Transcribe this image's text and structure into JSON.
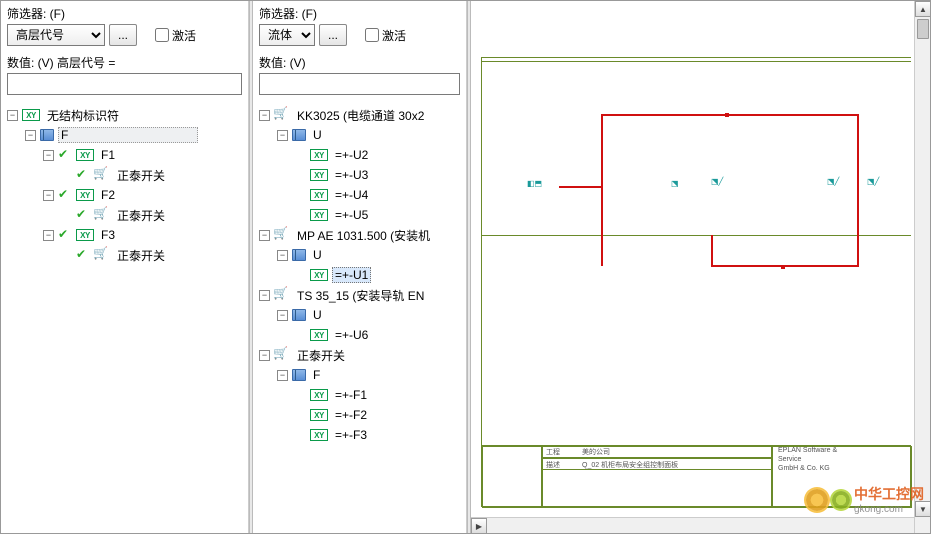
{
  "leftPanel": {
    "filterLabel": "筛选器: (F)",
    "filterCombo": "高层代号",
    "activateLabel": "激活",
    "valueLabel": "数值: (V) 高层代号 =",
    "valueInput": "",
    "ellipsis": "...",
    "tree": [
      {
        "level": 0,
        "exp": "-",
        "icon": "xy",
        "label": "无结构标识符"
      },
      {
        "level": 1,
        "exp": "-",
        "icon": "book",
        "label": "F",
        "sel": true
      },
      {
        "level": 2,
        "exp": "-",
        "icon": "check",
        "sub": "xy",
        "label": "F1"
      },
      {
        "level": 3,
        "exp": "",
        "icon": "check",
        "sub": "cart",
        "label": "正泰开关"
      },
      {
        "level": 2,
        "exp": "-",
        "icon": "check",
        "sub": "xy",
        "label": "F2"
      },
      {
        "level": 3,
        "exp": "",
        "icon": "check",
        "sub": "cart",
        "label": "正泰开关"
      },
      {
        "level": 2,
        "exp": "-",
        "icon": "check",
        "sub": "xy",
        "label": "F3"
      },
      {
        "level": 3,
        "exp": "",
        "icon": "check",
        "sub": "cart",
        "label": "正泰开关"
      }
    ]
  },
  "midPanel": {
    "filterLabel": "筛选器: (F)",
    "filterCombo": "流体",
    "activateLabel": "激活",
    "valueLabel": "数值: (V)",
    "valueInput": "",
    "ellipsis": "...",
    "tree": [
      {
        "level": 0,
        "exp": "-",
        "icon": "cart",
        "label": "KK3025 (电缆通道 30x2"
      },
      {
        "level": 1,
        "exp": "-",
        "icon": "book",
        "label": "U"
      },
      {
        "level": 2,
        "exp": "",
        "icon": "xy",
        "label": "=+-U2"
      },
      {
        "level": 2,
        "exp": "",
        "icon": "xy",
        "label": "=+-U3"
      },
      {
        "level": 2,
        "exp": "",
        "icon": "xy",
        "label": "=+-U4"
      },
      {
        "level": 2,
        "exp": "",
        "icon": "xy",
        "label": "=+-U5"
      },
      {
        "level": 0,
        "exp": "-",
        "icon": "cart",
        "label": "MP AE 1031.500 (安装机"
      },
      {
        "level": 1,
        "exp": "-",
        "icon": "book",
        "label": "U"
      },
      {
        "level": 2,
        "exp": "",
        "icon": "xy",
        "label": "=+-U1",
        "sel": true
      },
      {
        "level": 0,
        "exp": "-",
        "icon": "cart",
        "label": "TS 35_15 (安装导轨 EN"
      },
      {
        "level": 1,
        "exp": "-",
        "icon": "book",
        "label": "U"
      },
      {
        "level": 2,
        "exp": "",
        "icon": "xy",
        "label": "=+-U6"
      },
      {
        "level": 0,
        "exp": "-",
        "icon": "cart",
        "label": "正泰开关"
      },
      {
        "level": 1,
        "exp": "-",
        "icon": "book",
        "label": "F"
      },
      {
        "level": 2,
        "exp": "",
        "icon": "xy",
        "label": "=+-F1"
      },
      {
        "level": 2,
        "exp": "",
        "icon": "xy",
        "label": "=+-F2"
      },
      {
        "level": 2,
        "exp": "",
        "icon": "xy",
        "label": "=+-F3"
      }
    ]
  },
  "watermark": {
    "brand": "中华工控网",
    "domain": "gkong.com"
  },
  "titleblock": {
    "t1": "工程",
    "t2": "美的公司",
    "t3": "EPLAN Software &",
    "t4": "Service",
    "t5": "GmbH & Co. KG",
    "t6": "描述",
    "t7": "Q_02 机柜布局安全组控制面板"
  }
}
